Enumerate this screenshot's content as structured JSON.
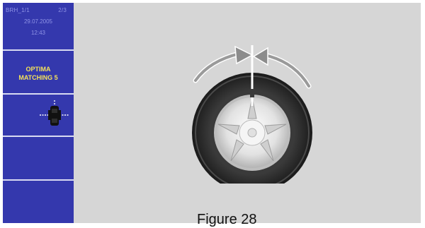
{
  "status": {
    "id": "BRH_1/1",
    "page": "2/3",
    "date": "29.07.2005",
    "time": "12:43"
  },
  "menu": {
    "program_line1": "OPTIMA",
    "program_line2": "MATCHING 5"
  },
  "icons": {
    "vehicle": "car-axle-icon",
    "rotate_cw": "rotate-clockwise-arrow-icon",
    "rotate_ccw": "rotate-counterclockwise-arrow-icon",
    "wheel": "wheel-icon"
  },
  "colors": {
    "sidebar": "#3438ad",
    "sidebar_text": "#8f93e6",
    "menu_text": "#f4e25a",
    "screen_bg": "#d6d6d6",
    "tire": "#2c2c2c"
  },
  "caption": "Figure 28"
}
